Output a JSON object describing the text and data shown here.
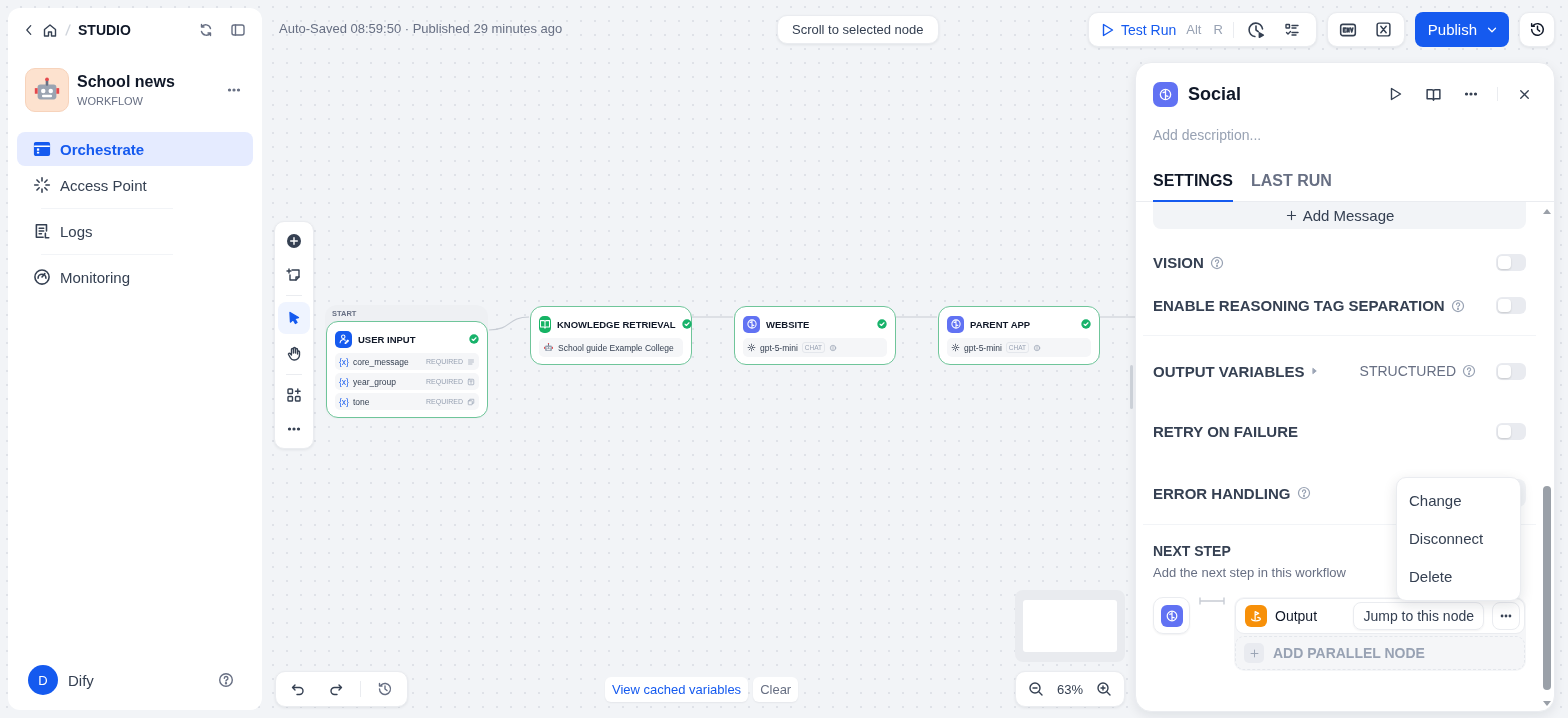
{
  "breadcrumb": {
    "label": "STUDIO"
  },
  "app": {
    "name": "School news",
    "type": "WORKFLOW"
  },
  "nav": [
    {
      "label": "Orchestrate",
      "selected": true
    },
    {
      "label": "Access Point",
      "selected": false
    },
    {
      "label": "Logs",
      "selected": false
    },
    {
      "label": "Monitoring",
      "selected": false
    }
  ],
  "user": {
    "initial": "D",
    "name": "Dify"
  },
  "status_text": "Auto-Saved 08:59:50 · Published 29 minutes ago",
  "scroll_button": "Scroll to selected node",
  "toolbar": {
    "test_run": "Test Run",
    "shortcut": [
      "Alt",
      "R"
    ],
    "publish": "Publish"
  },
  "nodes": [
    {
      "kind": "start",
      "group": "START",
      "title": "USER INPUT",
      "valid": true,
      "variables": [
        {
          "mark": "{x}",
          "name": "core_message",
          "required": "REQUIRED"
        },
        {
          "mark": "{x}",
          "name": "year_group",
          "required": "REQUIRED"
        },
        {
          "mark": "{x}",
          "name": "tone",
          "required": "REQUIRED"
        }
      ]
    },
    {
      "kind": "knowledge",
      "title": "KNOWLEDGE RETRIEVAL",
      "valid": true,
      "dataset": "School guide Example College"
    },
    {
      "kind": "llm",
      "title": "WEBSITE",
      "valid": true,
      "model": "gpt-5-mini",
      "mode": "CHAT"
    },
    {
      "kind": "llm",
      "title": "PARENT APP",
      "valid": true,
      "model": "gpt-5-mini",
      "mode": "CHAT"
    }
  ],
  "canvas_footer": {
    "cached": "View cached variables",
    "clear": "Clear",
    "zoom": "63%"
  },
  "panel": {
    "title": "Social",
    "description_placeholder": "Add description...",
    "tabs": [
      {
        "label": "SETTINGS",
        "selected": true
      },
      {
        "label": "LAST RUN",
        "selected": false
      }
    ],
    "add_message": "Add Message",
    "settings": [
      {
        "kind": "toggle",
        "label": "VISION",
        "help": true,
        "on": false
      },
      {
        "kind": "toggle",
        "label": "ENABLE REASONING TAG SEPARATION",
        "help": true,
        "on": false
      },
      {
        "kind": "output",
        "label": "OUTPUT VARIABLES",
        "structured": "STRUCTURED",
        "on": false
      },
      {
        "kind": "toggle",
        "label": "RETRY ON FAILURE",
        "help": false,
        "on": false
      },
      {
        "kind": "select",
        "label": "ERROR HANDLING",
        "help": true
      }
    ],
    "next_step": {
      "title": "NEXT STEP",
      "hint": "Add the next step in this workflow",
      "node": "Output",
      "jump": "Jump to this node",
      "add_parallel": "ADD PARALLEL NODE"
    },
    "menu": [
      "Change",
      "Disconnect",
      "Delete"
    ]
  }
}
